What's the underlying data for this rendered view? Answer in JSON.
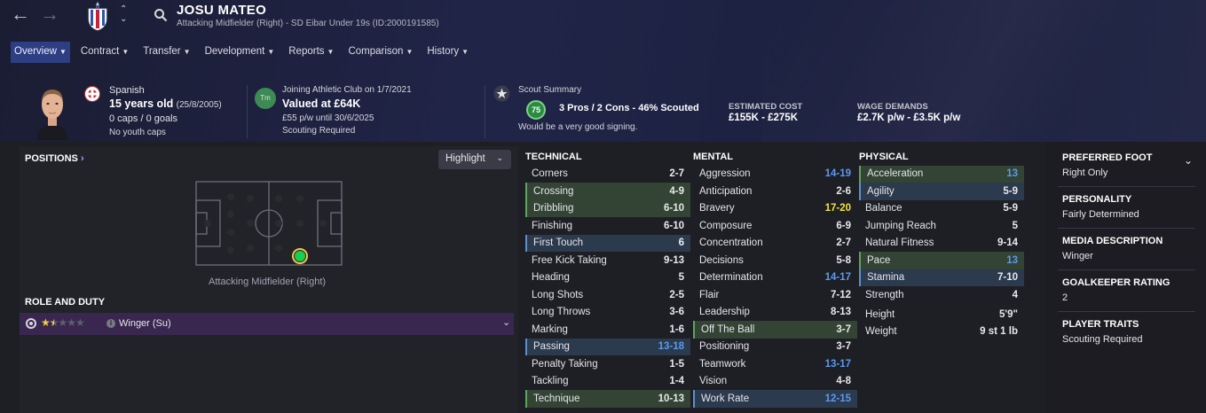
{
  "header": {
    "name": "JOSU MATEO",
    "subtitle": "Attacking Midfielder (Right) - SD Eibar Under 19s (ID:2000191585)"
  },
  "tabs": [
    {
      "label": "Overview"
    },
    {
      "label": "Contract"
    },
    {
      "label": "Transfer"
    },
    {
      "label": "Development"
    },
    {
      "label": "Reports"
    },
    {
      "label": "Comparison"
    },
    {
      "label": "History"
    }
  ],
  "info": {
    "nationality": "Spanish",
    "age": "15 years old",
    "dob": "(25/8/2005)",
    "caps": "0 caps / 0 goals",
    "youth_caps": "No youth caps"
  },
  "club": {
    "badge": "Tm",
    "joining": "Joining Athletic Club on 1/7/2021",
    "valued": "Valued at £64K",
    "wage": "£55 p/w until 30/6/2025",
    "scouting": "Scouting Required"
  },
  "scout": {
    "title": "Scout Summary",
    "rating": "75",
    "summary": "3 Pros / 2 Cons - 46% Scouted",
    "note": "Would be a very good signing.",
    "cost_label": "ESTIMATED COST",
    "cost": "£155K - £275K",
    "wage_label": "WAGE DEMANDS",
    "wage": "£2.7K p/w - £3.5K p/w"
  },
  "positions": {
    "title": "POSITIONS",
    "highlight": "Highlight",
    "position_label": "Attacking Midfielder (Right)"
  },
  "role": {
    "title": "ROLE AND DUTY",
    "role_name": "Winger (Su)",
    "stars": 1.5
  },
  "technical": {
    "title": "TECHNICAL",
    "attrs": [
      {
        "name": "Corners",
        "value": "2-7",
        "hl": "",
        "color": ""
      },
      {
        "name": "Crossing",
        "value": "4-9",
        "hl": "green",
        "color": ""
      },
      {
        "name": "Dribbling",
        "value": "6-10",
        "hl": "green",
        "color": ""
      },
      {
        "name": "Finishing",
        "value": "6-10",
        "hl": "",
        "color": ""
      },
      {
        "name": "First Touch",
        "value": "6",
        "hl": "blue",
        "color": "white"
      },
      {
        "name": "Free Kick Taking",
        "value": "9-13",
        "hl": "",
        "color": ""
      },
      {
        "name": "Heading",
        "value": "5",
        "hl": "",
        "color": ""
      },
      {
        "name": "Long Shots",
        "value": "2-5",
        "hl": "",
        "color": ""
      },
      {
        "name": "Long Throws",
        "value": "3-6",
        "hl": "",
        "color": ""
      },
      {
        "name": "Marking",
        "value": "1-6",
        "hl": "",
        "color": ""
      },
      {
        "name": "Passing",
        "value": "13-18",
        "hl": "blue",
        "color": "blue"
      },
      {
        "name": "Penalty Taking",
        "value": "1-5",
        "hl": "",
        "color": ""
      },
      {
        "name": "Tackling",
        "value": "1-4",
        "hl": "",
        "color": ""
      },
      {
        "name": "Technique",
        "value": "10-13",
        "hl": "green",
        "color": ""
      }
    ]
  },
  "mental": {
    "title": "MENTAL",
    "attrs": [
      {
        "name": "Aggression",
        "value": "14-19",
        "hl": "",
        "color": "blue"
      },
      {
        "name": "Anticipation",
        "value": "2-6",
        "hl": "",
        "color": ""
      },
      {
        "name": "Bravery",
        "value": "17-20",
        "hl": "",
        "color": "yellow"
      },
      {
        "name": "Composure",
        "value": "6-9",
        "hl": "",
        "color": ""
      },
      {
        "name": "Concentration",
        "value": "2-7",
        "hl": "",
        "color": ""
      },
      {
        "name": "Decisions",
        "value": "5-8",
        "hl": "",
        "color": ""
      },
      {
        "name": "Determination",
        "value": "14-17",
        "hl": "",
        "color": "blue"
      },
      {
        "name": "Flair",
        "value": "7-12",
        "hl": "",
        "color": ""
      },
      {
        "name": "Leadership",
        "value": "8-13",
        "hl": "",
        "color": ""
      },
      {
        "name": "Off The Ball",
        "value": "3-7",
        "hl": "green",
        "color": ""
      },
      {
        "name": "Positioning",
        "value": "3-7",
        "hl": "",
        "color": ""
      },
      {
        "name": "Teamwork",
        "value": "13-17",
        "hl": "",
        "color": "blue"
      },
      {
        "name": "Vision",
        "value": "4-8",
        "hl": "",
        "color": ""
      },
      {
        "name": "Work Rate",
        "value": "12-15",
        "hl": "blue",
        "color": "blue"
      }
    ]
  },
  "physical": {
    "title": "PHYSICAL",
    "attrs": [
      {
        "name": "Acceleration",
        "value": "13",
        "hl": "green",
        "color": "blue"
      },
      {
        "name": "Agility",
        "value": "5-9",
        "hl": "blue",
        "color": ""
      },
      {
        "name": "Balance",
        "value": "5-9",
        "hl": "",
        "color": ""
      },
      {
        "name": "Jumping Reach",
        "value": "5",
        "hl": "",
        "color": ""
      },
      {
        "name": "Natural Fitness",
        "value": "9-14",
        "hl": "",
        "color": ""
      },
      {
        "name": "Pace",
        "value": "13",
        "hl": "green",
        "color": "blue"
      },
      {
        "name": "Stamina",
        "value": "7-10",
        "hl": "blue",
        "color": ""
      },
      {
        "name": "Strength",
        "value": "4",
        "hl": "",
        "color": ""
      }
    ],
    "height_label": "Height",
    "height": "5'9\"",
    "weight_label": "Weight",
    "weight": "9 st 1 lb"
  },
  "right_panel": [
    {
      "label": "PREFERRED FOOT",
      "value": "Right Only"
    },
    {
      "label": "PERSONALITY",
      "value": "Fairly Determined"
    },
    {
      "label": "MEDIA DESCRIPTION",
      "value": "Winger"
    },
    {
      "label": "GOALKEEPER RATING",
      "value": "2"
    },
    {
      "label": "PLAYER TRAITS",
      "value": "Scouting Required"
    }
  ],
  "colors": {
    "accent": "#2d3f82",
    "highlight_green": "#334434",
    "highlight_blue": "#2c3a4d",
    "value_blue": "#5a9af0",
    "value_yellow": "#f2e33c"
  }
}
